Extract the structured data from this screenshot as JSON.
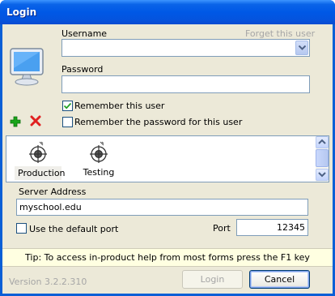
{
  "window": {
    "title": "Login"
  },
  "username": {
    "label": "Username",
    "value": "",
    "forget_link": "Forget this user"
  },
  "password": {
    "label": "Password",
    "value": ""
  },
  "options": {
    "remember_user": {
      "label": "Remember this user",
      "checked": true
    },
    "remember_password": {
      "label": "Remember the password for this user",
      "checked": false
    }
  },
  "servers": [
    {
      "label": "Production",
      "selected": true,
      "icon": "server-target-icon"
    },
    {
      "label": "Testing",
      "selected": false,
      "icon": "server-target-icon"
    }
  ],
  "server_address": {
    "label": "Server Address",
    "value": "myschool.edu"
  },
  "default_port": {
    "label": "Use the default port",
    "checked": false
  },
  "port": {
    "label": "Port",
    "value": "12345"
  },
  "tip": "Tip: To access in-product help from most forms press the F1 key",
  "version": "Version 3.2.2.310",
  "buttons": {
    "login": "Login",
    "cancel": "Cancel"
  },
  "colors": {
    "titlebar": "#0058e6",
    "face": "#ece9d8",
    "tip_bg": "#ffffe1",
    "add_icon": "#1aa51a",
    "remove_icon": "#e02020"
  }
}
